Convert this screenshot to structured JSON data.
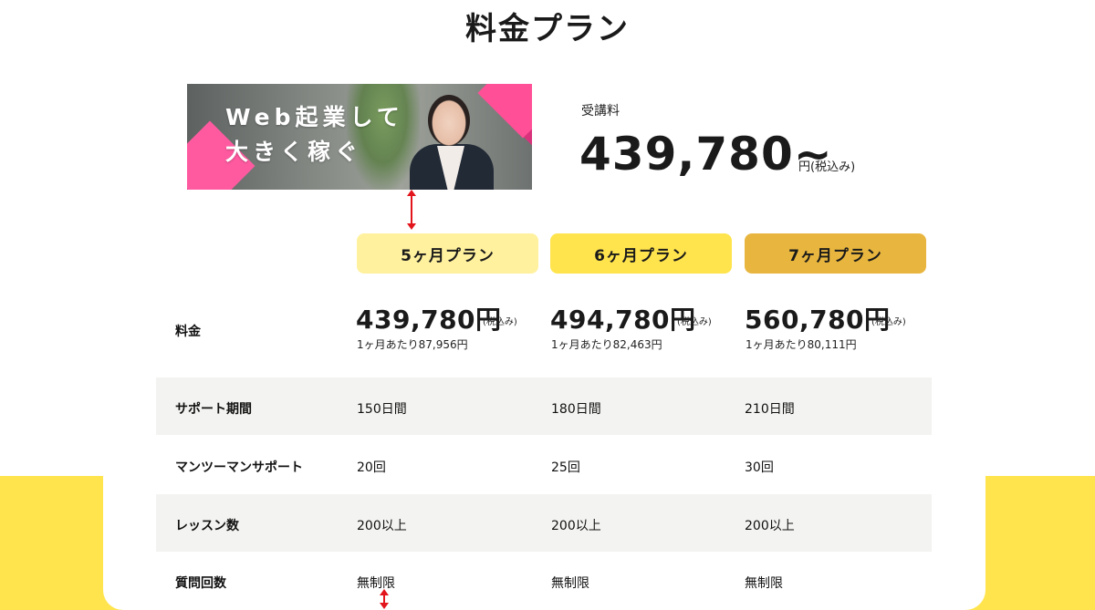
{
  "header": {
    "title": "料金プラン"
  },
  "banner": {
    "line1": "Web起業して",
    "line2": "大きく稼ぐ"
  },
  "fee": {
    "label": "受講料",
    "amount": "439,780~",
    "unit": "円(税込み)"
  },
  "plans": [
    {
      "name": "5ヶ月プラン",
      "color": "#fff19e",
      "price": "439,780円",
      "tax": "(税込み)",
      "per_month": "1ヶ月あたり87,956円",
      "support_period": "150日間",
      "mentor_support": "20回",
      "lessons": "200以上",
      "questions": "無制限"
    },
    {
      "name": "6ヶ月プラン",
      "color": "#ffe44d",
      "price": "494,780円",
      "tax": "(税込み)",
      "per_month": "1ヶ月あたり82,463円",
      "support_period": "180日間",
      "mentor_support": "25回",
      "lessons": "200以上",
      "questions": "無制限"
    },
    {
      "name": "7ヶ月プラン",
      "color": "#e8b63f",
      "price": "560,780円",
      "tax": "(税込み)",
      "per_month": "1ヶ月あたり80,111円",
      "support_period": "210日間",
      "mentor_support": "30回",
      "lessons": "200以上",
      "questions": "無制限"
    }
  ],
  "rows": {
    "price": "料金",
    "support_period": "サポート期間",
    "mentor_support": "マンツーマンサポート",
    "lessons": "レッスン数",
    "questions": "質問回数"
  },
  "colors": {
    "accent_pink": "#ff3d8b",
    "yellow_band": "#ffe44d",
    "row_gray": "#f3f3f1",
    "arrow_red": "#e2141c"
  }
}
